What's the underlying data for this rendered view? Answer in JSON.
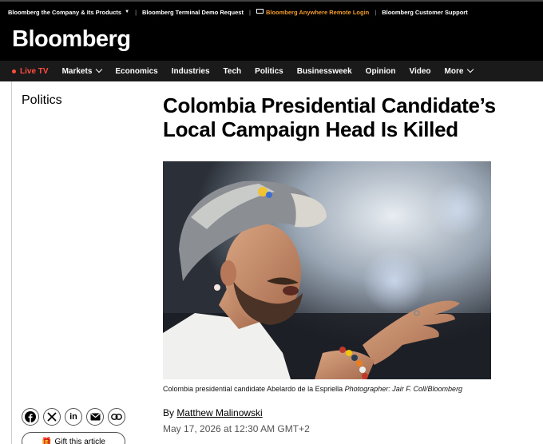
{
  "topbar": {
    "company": "Bloomberg the Company & Its Products",
    "terminal": "Bloomberg Terminal Demo Request",
    "anywhere": "Bloomberg Anywhere Remote Login",
    "support": "Bloomberg Customer Support"
  },
  "logo": "Bloomberg",
  "nav": {
    "live": "Live TV",
    "items": [
      "Markets",
      "Economics",
      "Industries",
      "Tech",
      "Politics",
      "Businessweek",
      "Opinion",
      "Video",
      "More"
    ]
  },
  "article": {
    "section": "Politics",
    "headline": "Colombia Presidential Candidate’s Local Campaign Head Is Killed",
    "caption": "Colombia presidential candidate Abelardo de la Espriella",
    "photo_credit": "Photographer: Jair F. Coll/Bloomberg",
    "by": "By",
    "author": "Matthew Malinowski",
    "date": "May 17, 2026 at 12:30 AM GMT+2",
    "gift": "Gift this article"
  },
  "share_icons": [
    "facebook-icon",
    "x-icon",
    "linkedin-icon",
    "email-icon",
    "link-icon"
  ],
  "colors": {
    "accent_orange": "#f29b2c",
    "live_red": "#ff4d3d",
    "header_bg": "#000000",
    "nav_bg": "#1a1a1a"
  }
}
